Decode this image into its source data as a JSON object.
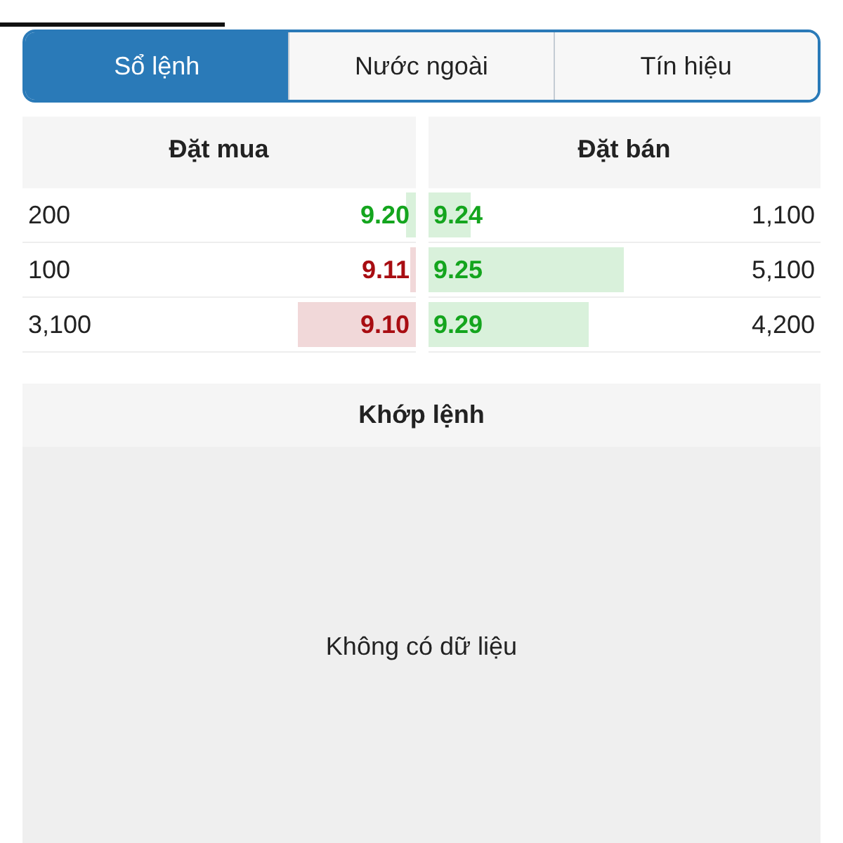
{
  "tabs": [
    {
      "label": "Sổ lệnh",
      "selected": true
    },
    {
      "label": "Nước ngoài",
      "selected": false
    },
    {
      "label": "Tín hiệu",
      "selected": false
    }
  ],
  "order_book": {
    "buy_title": "Đặt mua",
    "sell_title": "Đặt bán",
    "rows": [
      {
        "buy": {
          "volume": "200",
          "price": "9.20",
          "color": "#14a51e",
          "level": 0.025
        },
        "sell": {
          "price": "9.24",
          "color": "#14a51e",
          "level": 0.11,
          "volume": "1,100"
        }
      },
      {
        "buy": {
          "volume": "100",
          "price": "9.11",
          "color": "#a80d12",
          "level": 0.012
        },
        "sell": {
          "price": "9.25",
          "color": "#14a51e",
          "level": 0.5,
          "volume": "5,100"
        }
      },
      {
        "buy": {
          "volume": "3,100",
          "price": "9.10",
          "color": "#a80d12",
          "level": 0.3
        },
        "sell": {
          "price": "9.29",
          "color": "#14a51e",
          "level": 0.41,
          "volume": "4,200"
        }
      }
    ]
  },
  "matched": {
    "title": "Khớp lệnh",
    "empty_message": "Không có dữ liệu"
  }
}
